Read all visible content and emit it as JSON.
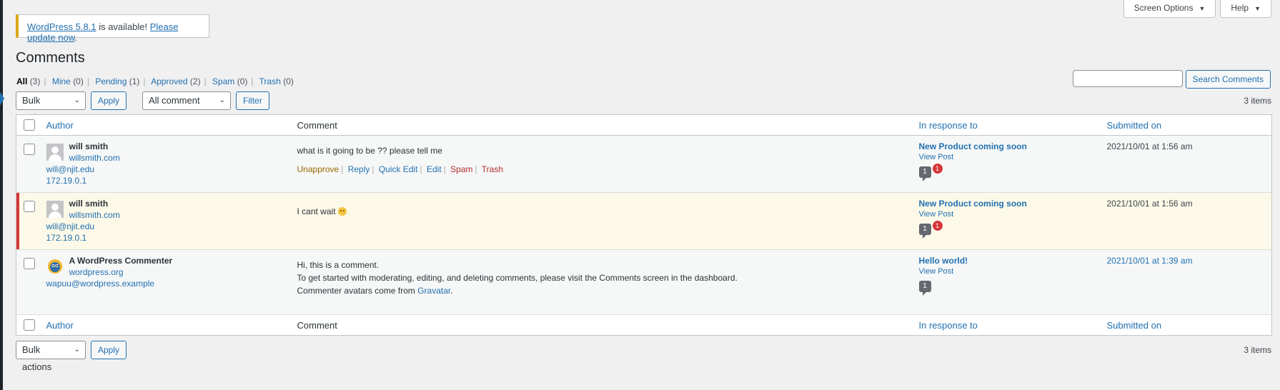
{
  "screen_meta": {
    "screen_options": "Screen Options",
    "help": "Help"
  },
  "notice": {
    "version_link": "WordPress 5.8.1",
    "middle": " is available! ",
    "update_link": "Please update now",
    "end": "."
  },
  "page_title": "Comments",
  "filters": [
    {
      "label": "All",
      "count": "(3)",
      "current": true
    },
    {
      "label": "Mine",
      "count": "(0)"
    },
    {
      "label": "Pending",
      "count": "(1)"
    },
    {
      "label": "Approved",
      "count": "(2)"
    },
    {
      "label": "Spam",
      "count": "(0)"
    },
    {
      "label": "Trash",
      "count": "(0)"
    }
  ],
  "search": {
    "button": "Search Comments",
    "value": ""
  },
  "top_nav": {
    "bulk_actions": "Bulk actions",
    "apply": "Apply",
    "comment_types": "All comment types",
    "filter": "Filter",
    "items": "3 items"
  },
  "columns": {
    "author": "Author",
    "comment": "Comment",
    "in_response_to": "In response to",
    "submitted_on": "Submitted on"
  },
  "comments": [
    {
      "author_name": "will smith",
      "author_url": "willsmith.com",
      "author_email": "will@njit.edu",
      "author_ip": "172.19.0.1",
      "text": "what is it going to be ?? please tell me",
      "actions": {
        "unapprove": "Unapprove",
        "reply": "Reply",
        "quick_edit": "Quick Edit",
        "edit": "Edit",
        "spam": "Spam",
        "trash": "Trash"
      },
      "post_title": "New Product coming soon",
      "view_post": "View Post",
      "count": "1",
      "pending": "1",
      "submitted": "2021/10/01 at 1:56 am"
    },
    {
      "author_name": "will smith",
      "author_url": "willsmith.com",
      "author_email": "will@njit.edu",
      "author_ip": "172.19.0.1",
      "text": "I cant wait ",
      "post_title": "New Product coming soon",
      "view_post": "View Post",
      "count": "1",
      "pending": "1",
      "submitted": "2021/10/01 at 1:56 am"
    },
    {
      "author_name": "A WordPress Commenter",
      "author_url": "wordpress.org",
      "author_email": "wapuu@wordpress.example",
      "text_line1": "Hi, this is a comment.",
      "text_line2": "To get started with moderating, editing, and deleting comments, please visit the Comments screen in the dashboard.",
      "text_line3": "Commenter avatars come from ",
      "gravatar": "Gravatar",
      "text_end": ".",
      "post_title": "Hello world!",
      "view_post": "View Post",
      "count": "1",
      "submitted": "2021/10/01 at 1:39 am"
    }
  ],
  "bottom_nav": {
    "bulk_actions": "Bulk actions",
    "apply": "Apply",
    "items": "3 items"
  }
}
